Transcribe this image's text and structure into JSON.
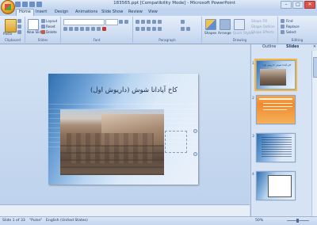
{
  "window": {
    "title": "183565.ppt [Compatibility Mode] - Microsoft PowerPoint",
    "controls": [
      "–",
      "□",
      "✕"
    ]
  },
  "ribbon": {
    "tabs": [
      "Home",
      "Insert",
      "Design",
      "Animations",
      "Slide Show",
      "Review",
      "View"
    ],
    "active_tab": "Home",
    "groups": {
      "clipboard": {
        "label": "Clipboard",
        "paste": "Paste"
      },
      "slides": {
        "label": "Slides",
        "new_slide": "New Slide",
        "layout": "Layout",
        "reset": "Reset",
        "delete": "Delete"
      },
      "font": {
        "label": "Font"
      },
      "paragraph": {
        "label": "Paragraph"
      },
      "drawing": {
        "label": "Drawing",
        "shapes": "Shapes",
        "arrange": "Arrange",
        "quick_styles": "Quick Styles",
        "shape_fill": "Shape Fill",
        "shape_outline": "Shape Outline",
        "shape_effects": "Shape Effects"
      },
      "editing": {
        "label": "Editing",
        "find": "Find",
        "replace": "Replace",
        "select": "Select"
      }
    }
  },
  "slide": {
    "title": "کاخ آپادانا شوش (داریوش اول)"
  },
  "panel": {
    "tabs": [
      "Outline",
      "Slides"
    ],
    "active_tab": "Slides",
    "thumbnails": [
      {
        "number": "1",
        "title": "کاخ آپادانا شوش (داریوش اول)"
      },
      {
        "number": "2",
        "title": ""
      },
      {
        "number": "3",
        "title": ""
      },
      {
        "number": "4",
        "title": ""
      }
    ]
  },
  "status": {
    "slide": "Slide 1 of 33",
    "theme": "\"Pulse\"",
    "language": "English (United States)",
    "zoom": "50%"
  },
  "colors": {
    "accent": "#f4b63b",
    "ribbon": "#cddcf1",
    "slide_blue": "#2f6fb0"
  }
}
